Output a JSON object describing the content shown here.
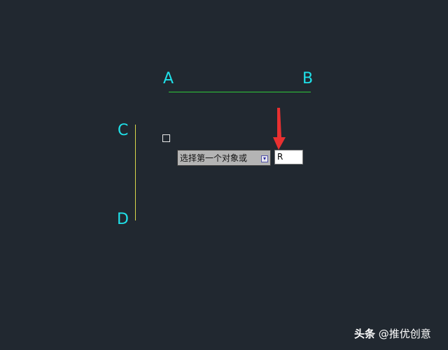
{
  "points": {
    "a": "A",
    "b": "B",
    "c": "C",
    "d": "D"
  },
  "prompt": {
    "text": "选择第一个对象或",
    "dropdown_icon": "dropdown-arrow-icon"
  },
  "command_input": {
    "value": "R"
  },
  "watermark": {
    "brand": "头条",
    "handle": "@推优创意"
  },
  "colors": {
    "background": "#212830",
    "point_label": "#1fe0e8",
    "line_ab": "#2fc93a",
    "line_cd": "#d8d64a",
    "arrow": "#e83030"
  }
}
